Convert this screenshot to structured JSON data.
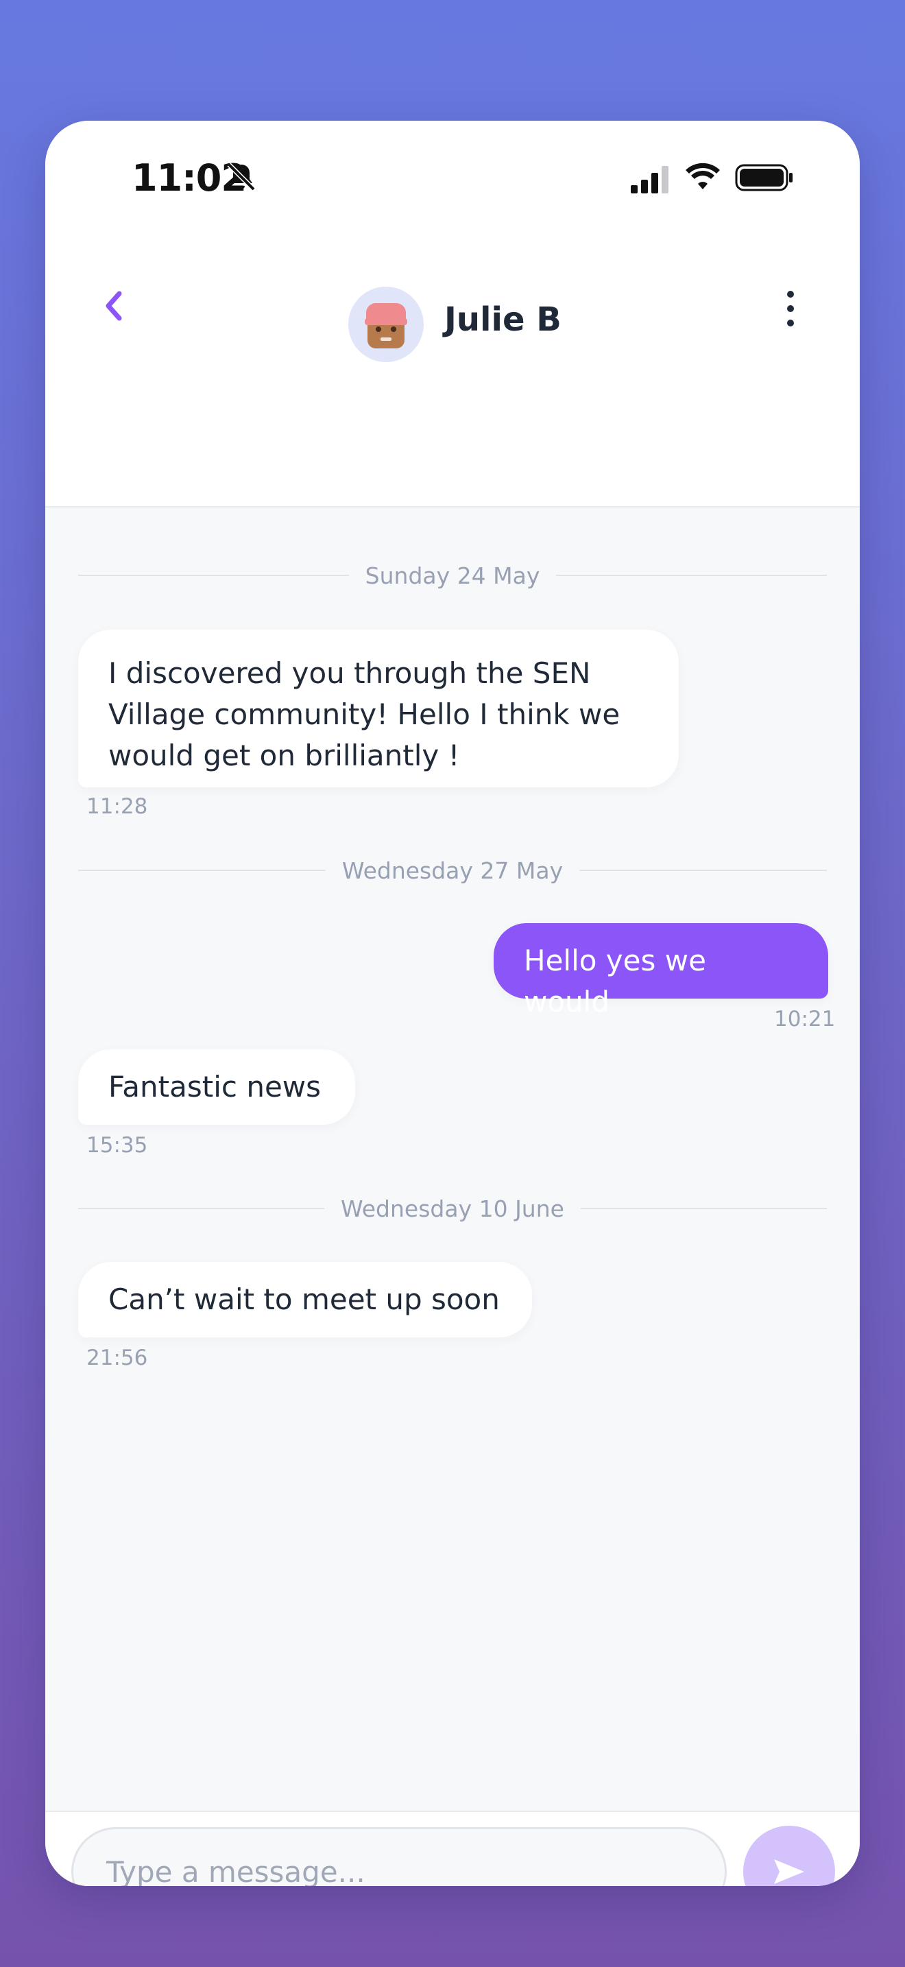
{
  "status_bar": {
    "time": "11:02",
    "icons": [
      "bell-slash-icon",
      "signal-icon",
      "wifi-icon",
      "battery-icon"
    ]
  },
  "header": {
    "back_icon": "chevron-left-icon",
    "contact_name": "Julie B",
    "avatar_icon": "person-avatar-icon",
    "more_icon": "vertical-ellipsis-icon"
  },
  "messages": [
    {
      "type": "date",
      "label": "Sunday 24 May"
    },
    {
      "type": "incoming",
      "text_lines": [
        "I discovered you through the SEN",
        "Village community! Hello I think we",
        "would get on brilliantly !"
      ],
      "time": "11:28"
    },
    {
      "type": "date",
      "label": "Wednesday 27 May"
    },
    {
      "type": "outgoing",
      "text": "Hello yes we would",
      "time": "10:21"
    },
    {
      "type": "incoming",
      "text": "Fantastic news",
      "time": "15:35"
    },
    {
      "type": "date",
      "label": "Wednesday 10 June"
    },
    {
      "type": "incoming",
      "text": "Can’t wait to meet up soon",
      "time": "21:56"
    }
  ],
  "composer": {
    "placeholder": "Type a message...",
    "value": "",
    "send_icon": "send-arrow-icon"
  },
  "colors": {
    "accent": "#8b55f7",
    "accent_light": "#d4c2fc",
    "chat_bg": "#f7f8fa",
    "text": "#1f2937",
    "muted": "#98a1b3",
    "background_top": "#6779e0",
    "background_bottom": "#7553ad"
  }
}
